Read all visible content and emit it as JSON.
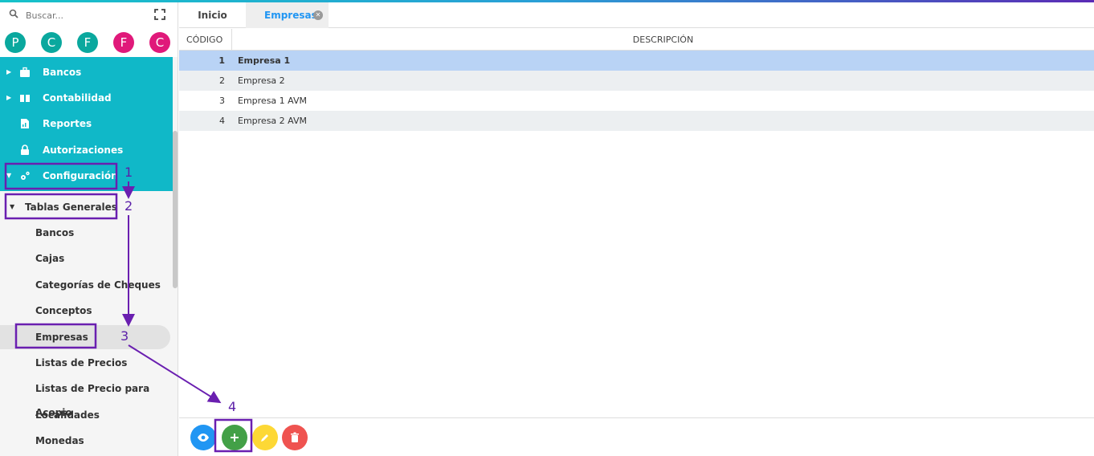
{
  "search": {
    "placeholder": "Buscar..."
  },
  "avatars": [
    {
      "letter": "P",
      "color": "#0aa89e"
    },
    {
      "letter": "C",
      "color": "#0aa89e"
    },
    {
      "letter": "F",
      "color": "#0aa89e"
    },
    {
      "letter": "F",
      "color": "#e0197a"
    },
    {
      "letter": "C",
      "color": "#e0197a"
    }
  ],
  "menu": {
    "bancos": "Bancos",
    "contabilidad": "Contabilidad",
    "reportes": "Reportes",
    "autorizaciones": "Autorizaciones",
    "configuracion": "Configuración"
  },
  "tablas_generales": {
    "label": "Tablas Generales",
    "items": [
      "Bancos",
      "Cajas",
      "Categorías de Cheques",
      "Conceptos",
      "Empresas",
      "Listas de Precios",
      "Listas de Precio para Acopio",
      "Localidades",
      "Monedas"
    ],
    "active_index": 4
  },
  "tabs": {
    "inicio": "Inicio",
    "empresas": "Empresas"
  },
  "table": {
    "headers": {
      "codigo": "CÓDIGO",
      "descripcion": "DESCRIPCIÓN"
    },
    "rows": [
      {
        "code": "1",
        "desc": "Empresa 1"
      },
      {
        "code": "2",
        "desc": "Empresa 2"
      },
      {
        "code": "3",
        "desc": "Empresa 1 AVM"
      },
      {
        "code": "4",
        "desc": "Empresa 2 AVM"
      }
    ]
  },
  "toolbar": {
    "view_color": "#2196f3",
    "add_color": "#43a047",
    "edit_color": "#fdd835",
    "delete_color": "#ef5350"
  },
  "annotations": {
    "n1": "1",
    "n2": "2",
    "n3": "3",
    "n4": "4",
    "color": "#6a1fb0"
  }
}
